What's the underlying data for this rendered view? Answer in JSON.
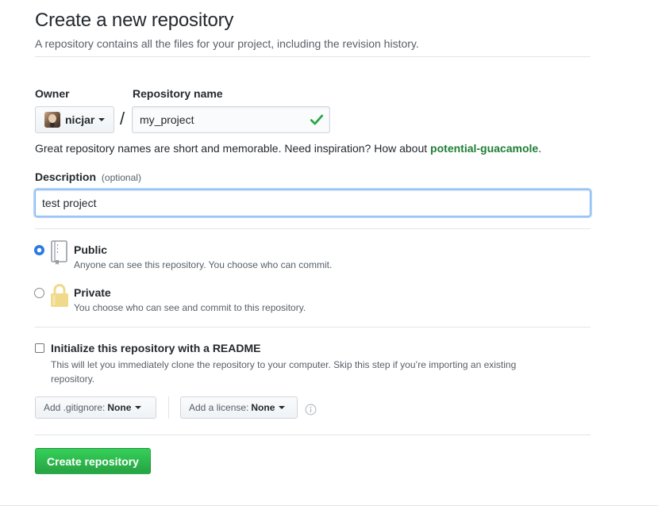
{
  "header": {
    "title": "Create a new repository",
    "subtitle": "A repository contains all the files for your project, including the revision history."
  },
  "owner": {
    "label": "Owner",
    "name": "nicjar"
  },
  "repo": {
    "label": "Repository name",
    "separator": "/",
    "value": "my_project",
    "hint_prefix": "Great repository names are short and memorable. Need inspiration? How about ",
    "suggestion": "potential-guacamole",
    "hint_suffix": "."
  },
  "description": {
    "label": "Description",
    "optional": "(optional)",
    "value": "test project"
  },
  "visibility": {
    "selected": "public",
    "public": {
      "title": "Public",
      "desc": "Anyone can see this repository. You choose who can commit."
    },
    "private": {
      "title": "Private",
      "desc": "You choose who can see and commit to this repository."
    }
  },
  "readme": {
    "checked": false,
    "title": "Initialize this repository with a README",
    "desc_line1": "This will let you immediately clone the repository to your computer. Skip this step if you’re importing an existing",
    "desc_line2": "repository."
  },
  "gitignore": {
    "prefix": "Add .gitignore:",
    "value": "None"
  },
  "license": {
    "prefix": "Add a license:",
    "value": "None"
  },
  "actions": {
    "create": "Create repository"
  },
  "colors": {
    "accent_green": "#28a745",
    "focus_blue": "#79b8ff",
    "radio_blue": "#2a7ae2"
  }
}
